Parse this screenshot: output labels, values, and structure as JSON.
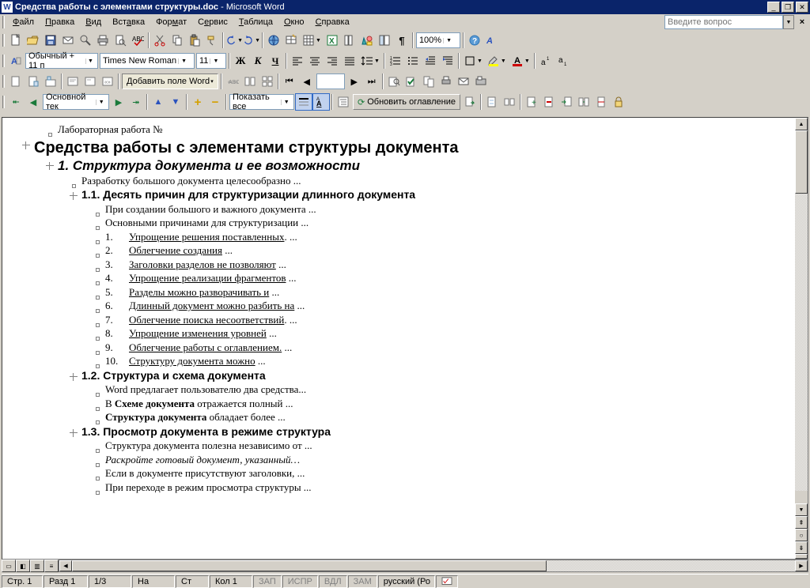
{
  "window": {
    "doc_title": "Средства работы с элементами структуры.doc",
    "app_name": "Microsoft Word"
  },
  "menu": {
    "file": "Файл",
    "edit": "Правка",
    "view": "Вид",
    "insert": "Вставка",
    "format": "Формат",
    "service": "Сервис",
    "table": "Таблица",
    "window": "Окно",
    "help": "Справка"
  },
  "ask_box": {
    "placeholder": "Введите вопрос"
  },
  "fmt": {
    "style": "Обычный + 11 п",
    "font": "Times New Roman",
    "size": "11",
    "zoom": "100%"
  },
  "wordfield": {
    "add": "Добавить поле Word"
  },
  "outline": {
    "style": "Основной тек",
    "show_all": "Показать все",
    "update_toc": "Обновить оглавление"
  },
  "doc": {
    "lab": "Лабораторная работа №",
    "title": "Средства работы с элементами структуры документа",
    "s1": "1. Структура документа и ее возможности",
    "s1_p": "Разработку большого документа целесообразно ...",
    "s11": "1.1. Десять причин для структуризации длинного документа",
    "s11_a": "При создании большого и важного документа ...",
    "s11_b": "Основными причинами для структуризации ...",
    "r": [
      {
        "n": "1.",
        "t": "Упрощение решения поставленных",
        "e": ". ..."
      },
      {
        "n": "2.",
        "t": "Облегчение создания",
        "e": " ..."
      },
      {
        "n": "3.",
        "t": "Заголовки разделов не позволяют",
        "e": " ..."
      },
      {
        "n": "4.",
        "t": "Упрощение реализации фрагментов",
        "e": " ..."
      },
      {
        "n": "5.",
        "t": "Разделы можно разворачивать и",
        "e": " ..."
      },
      {
        "n": "6.",
        "t": "Длинный документ можно разбить на",
        "e": " ..."
      },
      {
        "n": "7.",
        "t": "Облегчение поиска несоответствий",
        "e": ". ..."
      },
      {
        "n": "8.",
        "t": "Упрощение изменения уровней",
        "e": " ..."
      },
      {
        "n": "9.",
        "t": "Облегчение работы с оглавлением.",
        "e": " ..."
      },
      {
        "n": "10.",
        "t": "Структуру документа можно",
        "e": " ..."
      }
    ],
    "s12": "1.2. Структура и схема документа",
    "s12_a_pre": "Word предлагает пользователю два средства...",
    "s12_b_pre": "В ",
    "s12_b_bold": "Схеме документа",
    "s12_b_post": " отражается полный ...",
    "s12_c_bold": "Структура документа",
    "s12_c_post": " обладает более ...",
    "s13": "1.3. Просмотр документа в режиме структура",
    "s13_a": "Структура документа полезна независимо от ...",
    "s13_b": "Раскройте готовый документ, указанный…",
    "s13_c": "Если в документе присутствуют заголовки, ...",
    "s13_d": "При переходе в режим просмотра структуры ..."
  },
  "status": {
    "page": "Стр. 1",
    "section": "Разд 1",
    "pages": "1/3",
    "at": "На",
    "line": "Ст",
    "col": "Кол 1",
    "rec": "ЗАП",
    "fix": "ИСПР",
    "ext": "ВДЛ",
    "ovr": "ЗАМ",
    "lang": "русский (Ро"
  }
}
